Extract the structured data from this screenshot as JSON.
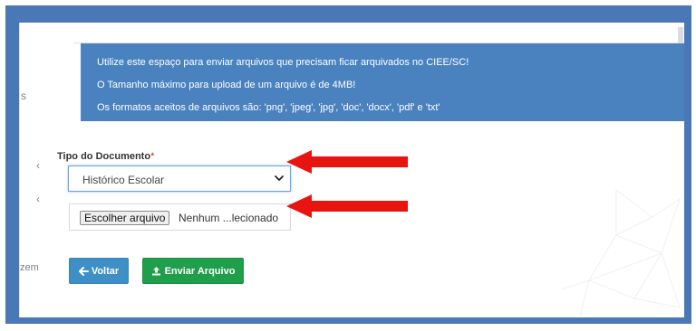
{
  "info_box": {
    "lines": [
      "Utilize este espaço para enviar arquivos que precisam ficar arquivados no CIEE/SC!",
      "O Tamanho máximo para upload de um arquivo é de 4MB!",
      "Os formatos aceitos de arquivos são: 'png', 'jpeg', 'jpg', 'doc', 'docx', 'pdf' e 'txt'"
    ]
  },
  "form": {
    "document_type_label": "Tipo do Documento",
    "required_mark": "*",
    "document_type_selected": "Histórico Escolar",
    "file_button_label": "Escolher arquivo",
    "file_status": "Nenhum ...lecionado"
  },
  "buttons": {
    "back_label": "Voltar",
    "send_label": "Enviar Arquivo",
    "back_color": "#3f8fc7",
    "send_color": "#1f9e4b"
  },
  "left_partial_text": {
    "fragment_s": "s",
    "fragment_zem": "zem",
    "chevron_1": "‹",
    "chevron_2": "‹"
  },
  "annotations": {
    "arrow_color": "#e8140f",
    "arrow_targets": [
      "document-type-select",
      "file-input"
    ]
  },
  "icons": {
    "back_icon": "arrow-left-icon",
    "send_icon": "upload-icon",
    "select_icon": "chevron-down-icon"
  }
}
